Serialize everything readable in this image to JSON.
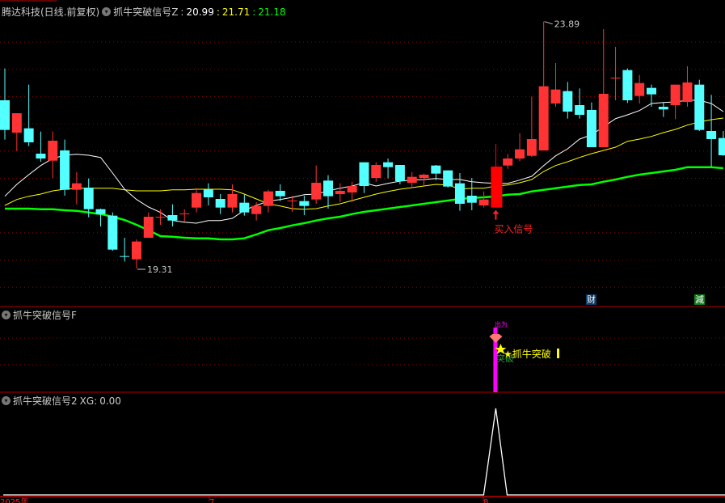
{
  "header": {
    "stock_title": "腾达科技(日线.前复权)",
    "indicator_name": "抓牛突破信号Z",
    "values": [
      "20.99",
      "21.71",
      "21.18"
    ]
  },
  "panel2": {
    "title": "抓牛突破信号F",
    "signal_text": "★抓牛突破",
    "sub_text": "突破",
    "top_text": "出为"
  },
  "panel3": {
    "title": "抓牛突破信号2",
    "xg_label": "XG:",
    "xg_value": "0.00"
  },
  "annotations": {
    "high_label": "23.89",
    "low_label": "19.31",
    "buy_signal": "买入信号",
    "tag_cai": "财",
    "tag_jian": "減"
  },
  "x_axis": {
    "labels": [
      "2025年",
      "7",
      "8"
    ]
  },
  "colors": {
    "up": "#ff3333",
    "down": "#54ffff",
    "ma1": "#ffffff",
    "ma2": "#ffff00",
    "ma3": "#00ff00",
    "grid": "#8b0000",
    "signal": "#ff00ff"
  },
  "chart_data": {
    "type": "candlestick",
    "title": "腾达科技(日线.前复权)",
    "ylim": [
      19.0,
      24.3
    ],
    "candles": [
      [
        22.43,
        23.02,
        21.7,
        21.88
      ],
      [
        21.83,
        22.19,
        21.49,
        22.19
      ],
      [
        21.91,
        22.72,
        21.58,
        21.65
      ],
      [
        21.44,
        21.85,
        21.29,
        21.35
      ],
      [
        21.31,
        21.85,
        20.99,
        21.68
      ],
      [
        21.5,
        21.7,
        20.66,
        20.77
      ],
      [
        20.77,
        21.1,
        20.5,
        20.89
      ],
      [
        20.81,
        20.98,
        20.26,
        20.41
      ],
      [
        20.41,
        20.42,
        20.09,
        20.32
      ],
      [
        20.29,
        20.35,
        19.64,
        19.66
      ],
      [
        19.54,
        19.88,
        19.44,
        19.53
      ],
      [
        19.48,
        19.85,
        19.31,
        19.81
      ],
      [
        19.88,
        20.35,
        19.88,
        20.27
      ],
      [
        20.26,
        20.41,
        20.12,
        20.27
      ],
      [
        20.3,
        20.5,
        20.09,
        20.2
      ],
      [
        20.32,
        20.41,
        20.18,
        20.33
      ],
      [
        20.44,
        20.8,
        20.35,
        20.71
      ],
      [
        20.78,
        20.89,
        20.48,
        20.63
      ],
      [
        20.6,
        20.69,
        20.32,
        20.44
      ],
      [
        20.44,
        20.87,
        20.35,
        20.69
      ],
      [
        20.53,
        20.68,
        20.29,
        20.35
      ],
      [
        20.32,
        20.54,
        20.2,
        20.47
      ],
      [
        20.47,
        20.77,
        20.35,
        20.74
      ],
      [
        20.75,
        20.87,
        20.56,
        20.65
      ],
      [
        20.56,
        20.66,
        20.36,
        20.57
      ],
      [
        20.56,
        20.66,
        20.3,
        20.47
      ],
      [
        20.59,
        21.22,
        20.51,
        20.9
      ],
      [
        20.94,
        21.04,
        20.42,
        20.65
      ],
      [
        20.69,
        20.89,
        20.54,
        20.75
      ],
      [
        20.72,
        20.92,
        20.54,
        20.84
      ],
      [
        21.28,
        21.28,
        20.71,
        20.84
      ],
      [
        20.99,
        21.28,
        20.92,
        21.23
      ],
      [
        21.28,
        21.35,
        20.98,
        21.19
      ],
      [
        21.23,
        21.23,
        20.87,
        20.93
      ],
      [
        20.9,
        21.1,
        20.83,
        21.01
      ],
      [
        20.99,
        21.07,
        20.84,
        21.05
      ],
      [
        21.22,
        21.23,
        20.95,
        21.07
      ],
      [
        21.13,
        21.13,
        20.81,
        20.83
      ],
      [
        20.89,
        21.08,
        20.38,
        20.51
      ],
      [
        20.66,
        20.99,
        20.39,
        20.53
      ],
      [
        20.48,
        20.74,
        20.44,
        20.59
      ],
      [
        20.44,
        21.62,
        20.44,
        21.2
      ],
      [
        21.22,
        21.43,
        21.16,
        21.35
      ],
      [
        21.35,
        21.82,
        21.3,
        21.52
      ],
      [
        21.4,
        22.5,
        21.38,
        21.71
      ],
      [
        21.5,
        23.89,
        21.5,
        22.69
      ],
      [
        22.37,
        23.12,
        22.31,
        22.63
      ],
      [
        22.6,
        22.77,
        22.09,
        22.22
      ],
      [
        22.34,
        22.65,
        22.09,
        22.16
      ],
      [
        22.25,
        22.39,
        21.56,
        21.56
      ],
      [
        21.56,
        23.75,
        21.56,
        22.55
      ],
      [
        22.84,
        23.42,
        22.43,
        22.85
      ],
      [
        22.99,
        23.02,
        22.38,
        22.43
      ],
      [
        22.51,
        22.9,
        22.37,
        22.75
      ],
      [
        22.66,
        22.72,
        22.31,
        22.54
      ],
      [
        22.31,
        22.4,
        22.12,
        22.26
      ],
      [
        22.34,
        22.72,
        22.08,
        22.72
      ],
      [
        22.4,
        23.06,
        22.31,
        22.76
      ],
      [
        22.72,
        22.81,
        21.86,
        21.88
      ],
      [
        21.86,
        22.53,
        21.2,
        21.71
      ],
      [
        21.73,
        21.86,
        21.4,
        21.41
      ]
    ],
    "ma_white": [
      20.65,
      20.87,
      21.05,
      21.22,
      21.35,
      21.41,
      21.43,
      21.41,
      21.37,
      21.08,
      20.78,
      20.59,
      20.45,
      20.35,
      20.2,
      20.17,
      20.15,
      20.2,
      20.2,
      20.24,
      20.39,
      20.48,
      20.56,
      20.59,
      20.63,
      20.68,
      20.69,
      20.75,
      20.8,
      20.84,
      20.9,
      20.84,
      20.89,
      20.93,
      20.95,
      20.96,
      20.98,
      20.96,
      20.96,
      20.92,
      20.9,
      20.89,
      20.89,
      20.95,
      21.02,
      21.22,
      21.4,
      21.53,
      21.71,
      21.79,
      21.94,
      22.09,
      22.16,
      22.24,
      22.37,
      22.39,
      22.4,
      22.43,
      22.43,
      22.37,
      22.22
    ],
    "ma_yellow": [
      20.48,
      20.59,
      20.65,
      20.69,
      20.75,
      20.78,
      20.8,
      20.8,
      20.8,
      20.8,
      20.77,
      20.75,
      20.75,
      20.75,
      20.77,
      20.77,
      20.78,
      20.78,
      20.78,
      20.77,
      20.69,
      20.6,
      20.51,
      20.47,
      20.42,
      20.41,
      20.42,
      20.47,
      20.51,
      20.57,
      20.63,
      20.69,
      20.74,
      20.78,
      20.81,
      20.84,
      20.87,
      20.86,
      20.78,
      20.8,
      20.8,
      20.84,
      20.86,
      20.9,
      20.96,
      21.11,
      21.22,
      21.29,
      21.37,
      21.44,
      21.5,
      21.56,
      21.67,
      21.71,
      21.76,
      21.83,
      21.89,
      21.97,
      22.03,
      22.07,
      22.1
    ],
    "ma_green": [
      20.42,
      20.42,
      20.42,
      20.41,
      20.41,
      20.39,
      20.38,
      20.35,
      20.32,
      20.27,
      20.21,
      20.12,
      20.02,
      19.91,
      19.9,
      19.88,
      19.87,
      19.87,
      19.85,
      19.85,
      19.87,
      19.94,
      20.02,
      20.06,
      20.11,
      20.15,
      20.2,
      20.24,
      20.27,
      20.32,
      20.36,
      20.39,
      20.42,
      20.45,
      20.48,
      20.51,
      20.54,
      20.57,
      20.6,
      20.62,
      20.63,
      20.65,
      20.68,
      20.69,
      20.74,
      20.77,
      20.8,
      20.83,
      20.86,
      20.87,
      20.92,
      20.96,
      21.01,
      21.05,
      21.08,
      21.11,
      21.14,
      21.19,
      21.19,
      21.19,
      21.17
    ],
    "high_index": 45,
    "low_index": 11,
    "buy_index": 41,
    "xg_series_peak_index": 41,
    "xg_peak_value": 1,
    "xg_current": 0
  }
}
